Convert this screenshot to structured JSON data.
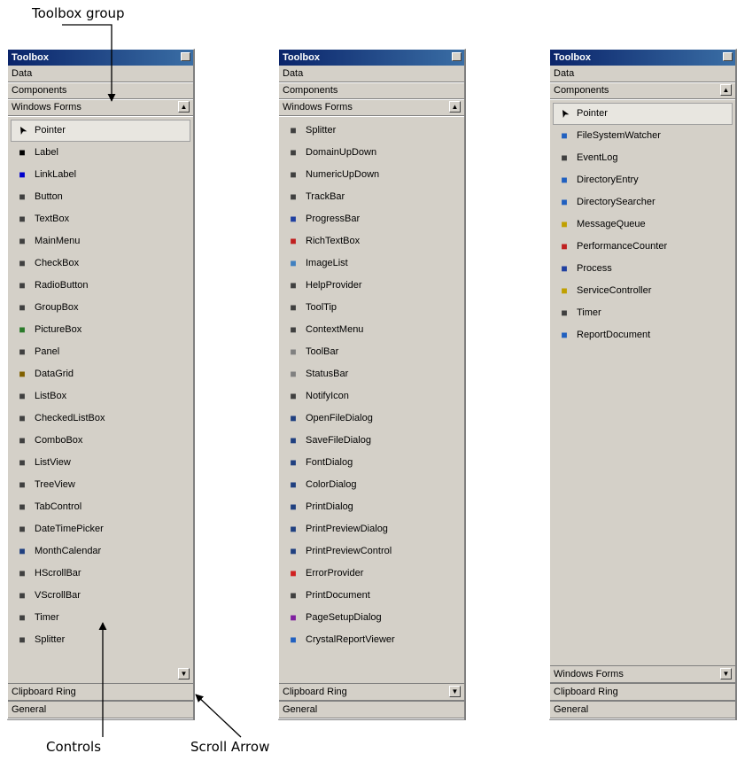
{
  "callouts": {
    "toolbox_group": "Toolbox group",
    "controls": "Controls",
    "scroll_arrow": "Scroll Arrow"
  },
  "panels": [
    {
      "title": "Toolbox",
      "top_tabs": [
        "Data",
        "Components",
        "Windows Forms"
      ],
      "items": [
        {
          "label": "Pointer",
          "icon": "pointer-icon",
          "color": "#000000"
        },
        {
          "label": "Label",
          "icon": "label-icon",
          "color": "#000000"
        },
        {
          "label": "LinkLabel",
          "icon": "linklabel-icon",
          "color": "#0000cc"
        },
        {
          "label": "Button",
          "icon": "button-icon",
          "color": "#404040"
        },
        {
          "label": "TextBox",
          "icon": "textbox-icon",
          "color": "#404040"
        },
        {
          "label": "MainMenu",
          "icon": "mainmenu-icon",
          "color": "#404040"
        },
        {
          "label": "CheckBox",
          "icon": "checkbox-icon",
          "color": "#404040"
        },
        {
          "label": "RadioButton",
          "icon": "radiobutton-icon",
          "color": "#404040"
        },
        {
          "label": "GroupBox",
          "icon": "groupbox-icon",
          "color": "#404040"
        },
        {
          "label": "PictureBox",
          "icon": "picturebox-icon",
          "color": "#2a7a2a"
        },
        {
          "label": "Panel",
          "icon": "panel-icon",
          "color": "#404040"
        },
        {
          "label": "DataGrid",
          "icon": "datagrid-icon",
          "color": "#806000"
        },
        {
          "label": "ListBox",
          "icon": "listbox-icon",
          "color": "#404040"
        },
        {
          "label": "CheckedListBox",
          "icon": "checkedlistbox-icon",
          "color": "#404040"
        },
        {
          "label": "ComboBox",
          "icon": "combobox-icon",
          "color": "#404040"
        },
        {
          "label": "ListView",
          "icon": "listview-icon",
          "color": "#404040"
        },
        {
          "label": "TreeView",
          "icon": "treeview-icon",
          "color": "#404040"
        },
        {
          "label": "TabControl",
          "icon": "tabcontrol-icon",
          "color": "#404040"
        },
        {
          "label": "DateTimePicker",
          "icon": "datetimepicker-icon",
          "color": "#404040"
        },
        {
          "label": "MonthCalendar",
          "icon": "monthcalendar-icon",
          "color": "#204080"
        },
        {
          "label": "HScrollBar",
          "icon": "hscrollbar-icon",
          "color": "#404040"
        },
        {
          "label": "VScrollBar",
          "icon": "vscrollbar-icon",
          "color": "#404040"
        },
        {
          "label": "Timer",
          "icon": "timer-icon",
          "color": "#404040"
        },
        {
          "label": "Splitter",
          "icon": "splitter-icon",
          "color": "#404040"
        }
      ],
      "bottom_tabs": [
        "Clipboard Ring",
        "General"
      ]
    },
    {
      "title": "Toolbox",
      "top_tabs": [
        "Data",
        "Components",
        "Windows Forms"
      ],
      "items": [
        {
          "label": "Splitter",
          "icon": "splitter-icon",
          "color": "#404040"
        },
        {
          "label": "DomainUpDown",
          "icon": "domainupdown-icon",
          "color": "#404040"
        },
        {
          "label": "NumericUpDown",
          "icon": "numericupdown-icon",
          "color": "#404040"
        },
        {
          "label": "TrackBar",
          "icon": "trackbar-icon",
          "color": "#404040"
        },
        {
          "label": "ProgressBar",
          "icon": "progressbar-icon",
          "color": "#2040a0"
        },
        {
          "label": "RichTextBox",
          "icon": "richtextbox-icon",
          "color": "#c02020"
        },
        {
          "label": "ImageList",
          "icon": "imagelist-icon",
          "color": "#4080c0"
        },
        {
          "label": "HelpProvider",
          "icon": "helpprovider-icon",
          "color": "#404040"
        },
        {
          "label": "ToolTip",
          "icon": "tooltip-icon",
          "color": "#404040"
        },
        {
          "label": "ContextMenu",
          "icon": "contextmenu-icon",
          "color": "#404040"
        },
        {
          "label": "ToolBar",
          "icon": "toolbar-icon",
          "color": "#808080"
        },
        {
          "label": "StatusBar",
          "icon": "statusbar-icon",
          "color": "#808080"
        },
        {
          "label": "NotifyIcon",
          "icon": "notifyicon-icon",
          "color": "#404040"
        },
        {
          "label": "OpenFileDialog",
          "icon": "openfiledialog-icon",
          "color": "#204080"
        },
        {
          "label": "SaveFileDialog",
          "icon": "savefiledialog-icon",
          "color": "#204080"
        },
        {
          "label": "FontDialog",
          "icon": "fontdialog-icon",
          "color": "#204080"
        },
        {
          "label": "ColorDialog",
          "icon": "colordialog-icon",
          "color": "#204080"
        },
        {
          "label": "PrintDialog",
          "icon": "printdialog-icon",
          "color": "#204080"
        },
        {
          "label": "PrintPreviewDialog",
          "icon": "printpreviewdialog-icon",
          "color": "#204080"
        },
        {
          "label": "PrintPreviewControl",
          "icon": "printpreviewcontrol-icon",
          "color": "#204080"
        },
        {
          "label": "ErrorProvider",
          "icon": "errorprovider-icon",
          "color": "#d02020"
        },
        {
          "label": "PrintDocument",
          "icon": "printdocument-icon",
          "color": "#404040"
        },
        {
          "label": "PageSetupDialog",
          "icon": "pagesetupdialog-icon",
          "color": "#8020a0"
        },
        {
          "label": "CrystalReportViewer",
          "icon": "crystalreportviewer-icon",
          "color": "#2060c0"
        }
      ],
      "bottom_tabs": [
        "Clipboard Ring",
        "General"
      ]
    },
    {
      "title": "Toolbox",
      "top_tabs": [
        "Data",
        "Components"
      ],
      "items": [
        {
          "label": "Pointer",
          "icon": "pointer-icon",
          "color": "#000000"
        },
        {
          "label": "FileSystemWatcher",
          "icon": "filesystemwatcher-icon",
          "color": "#2060c0"
        },
        {
          "label": "EventLog",
          "icon": "eventlog-icon",
          "color": "#404040"
        },
        {
          "label": "DirectoryEntry",
          "icon": "directoryentry-icon",
          "color": "#2060c0"
        },
        {
          "label": "DirectorySearcher",
          "icon": "directorysearcher-icon",
          "color": "#2060c0"
        },
        {
          "label": "MessageQueue",
          "icon": "messagequeue-icon",
          "color": "#c0a000"
        },
        {
          "label": "PerformanceCounter",
          "icon": "performancecounter-icon",
          "color": "#c02020"
        },
        {
          "label": "Process",
          "icon": "process-icon",
          "color": "#2040a0"
        },
        {
          "label": "ServiceController",
          "icon": "servicecontroller-icon",
          "color": "#c0a000"
        },
        {
          "label": "Timer",
          "icon": "timer-icon",
          "color": "#404040"
        },
        {
          "label": "ReportDocument",
          "icon": "reportdocument-icon",
          "color": "#2060c0"
        }
      ],
      "bottom_tabs": [
        "Windows Forms",
        "Clipboard Ring",
        "General"
      ]
    }
  ]
}
